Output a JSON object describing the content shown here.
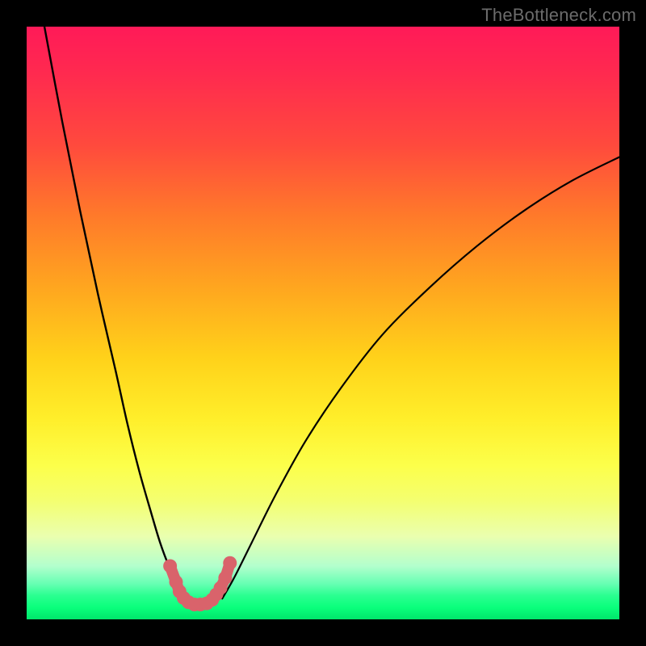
{
  "watermark": "TheBottleneck.com",
  "chart_data": {
    "type": "line",
    "title": "",
    "xlabel": "",
    "ylabel": "",
    "xlim": [
      0,
      100
    ],
    "ylim": [
      0,
      100
    ],
    "grid": false,
    "legend": false,
    "gradient_stops": [
      {
        "pos": 0,
        "color": "#ff1a58"
      },
      {
        "pos": 20,
        "color": "#ff4a3d"
      },
      {
        "pos": 44,
        "color": "#ffa61f"
      },
      {
        "pos": 66,
        "color": "#ffee2a"
      },
      {
        "pos": 86,
        "color": "#eaffaf"
      },
      {
        "pos": 96,
        "color": "#2aff90"
      },
      {
        "pos": 100,
        "color": "#00e56b"
      }
    ],
    "series": [
      {
        "name": "left-branch",
        "x": [
          3,
          6,
          9,
          12,
          15,
          17,
          19,
          21,
          22.5,
          24,
          25.5,
          27
        ],
        "y": [
          100,
          84,
          69,
          55,
          42,
          33,
          25,
          18,
          13,
          9,
          6,
          3.5
        ]
      },
      {
        "name": "right-branch",
        "x": [
          33,
          35,
          38,
          42,
          47,
          53,
          60,
          68,
          76,
          84,
          92,
          100
        ],
        "y": [
          3.5,
          7,
          13,
          21,
          30,
          39,
          48,
          56,
          63,
          69,
          74,
          78
        ]
      },
      {
        "name": "valley-marker",
        "marker_color": "#d9636b",
        "x": [
          24.2,
          25.2,
          25.8,
          26.5,
          27.3,
          28.3,
          29.3,
          30.4,
          31.3,
          32.0,
          32.7,
          33.5,
          34.3
        ],
        "y": [
          9.0,
          6.3,
          4.7,
          3.6,
          2.9,
          2.5,
          2.5,
          2.7,
          3.3,
          4.2,
          5.3,
          7.0,
          9.5
        ]
      }
    ]
  }
}
